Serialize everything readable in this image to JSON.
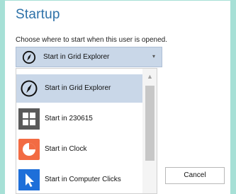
{
  "page": {
    "title": "Startup",
    "subtitle": "Choose where to start when this user is opened."
  },
  "select": {
    "value": "Start in Grid Explorer",
    "icon": "compass-icon"
  },
  "dropdown": {
    "items": [
      {
        "label": "Start in Grid Explorer",
        "icon": "compass-icon",
        "selected": true
      },
      {
        "label": "Start in 230615",
        "icon": "grid-icon",
        "selected": false
      },
      {
        "label": "Start in Clock",
        "icon": "clock-icon",
        "selected": false
      },
      {
        "label": "Start in Computer Clicks",
        "icon": "pointer-icon",
        "selected": false
      }
    ]
  },
  "buttons": {
    "cancel_label": "Cancel"
  },
  "colors": {
    "frame": "#a6e0d6",
    "title": "#2d71a8",
    "highlight": "#c9d7e8",
    "grid_tile": "#5a5a5a",
    "clock_tile": "#f26b43",
    "pointer_tile": "#1e6fd9"
  }
}
